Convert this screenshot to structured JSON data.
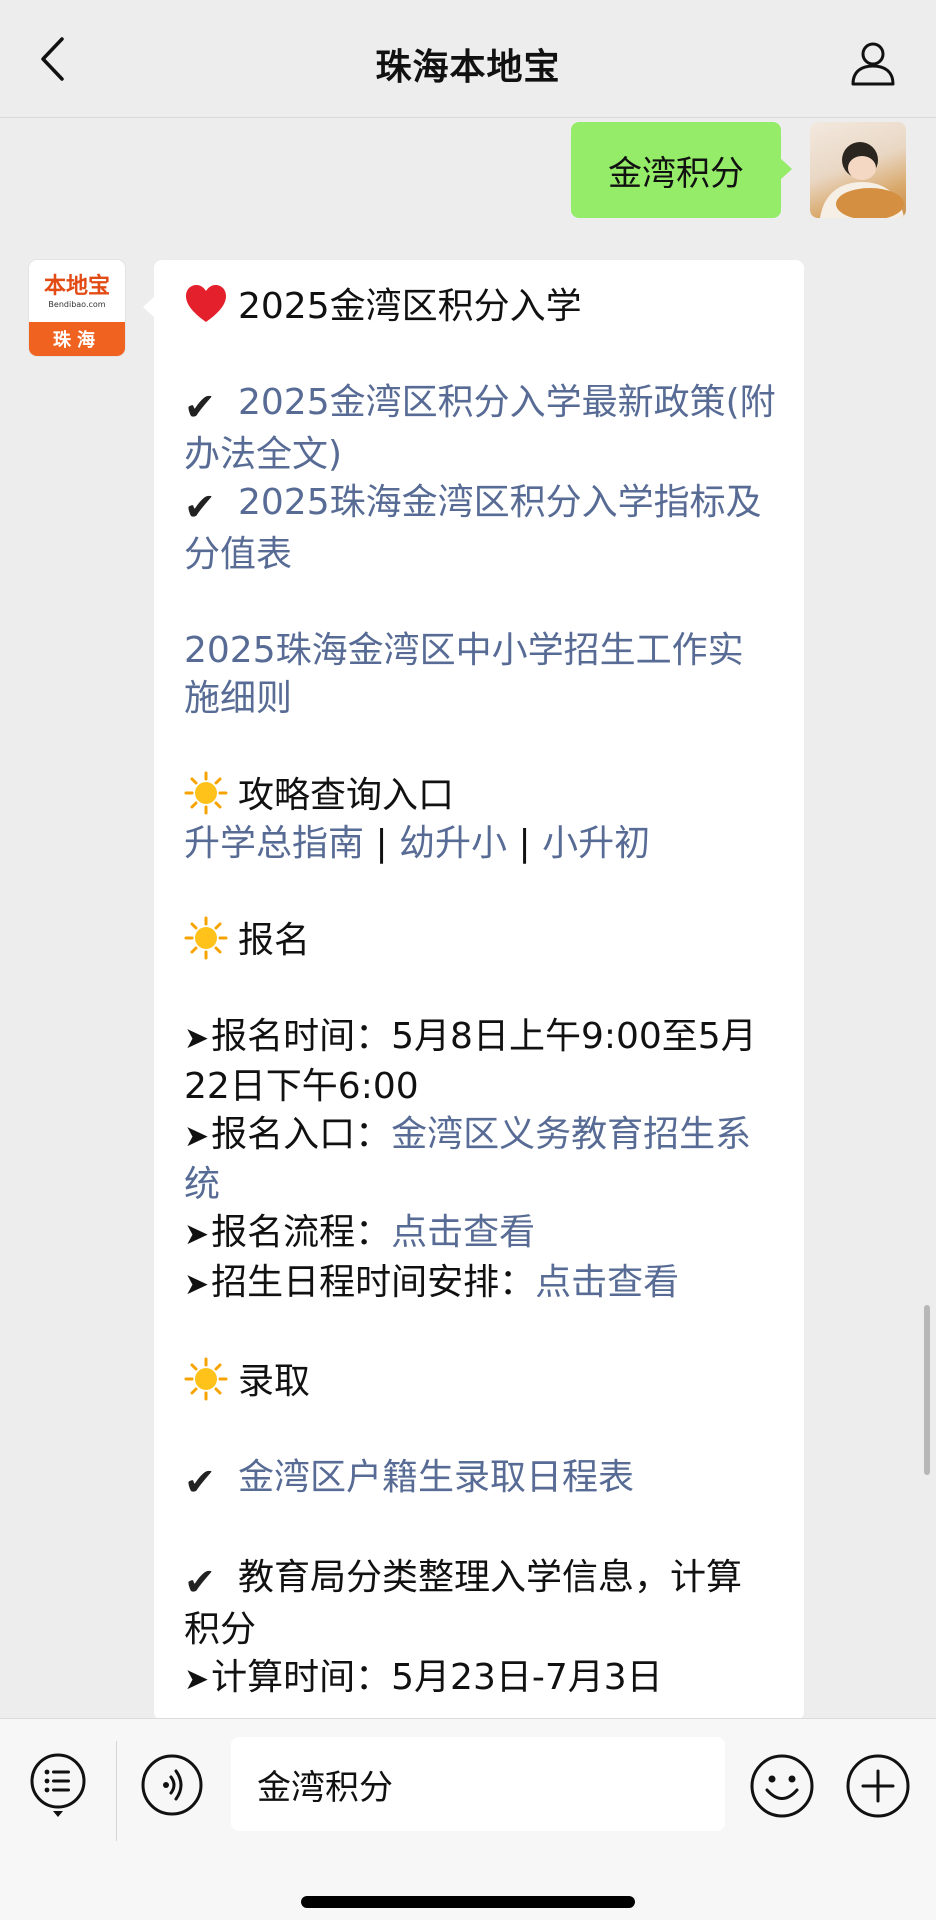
{
  "header": {
    "title": "珠海本地宝"
  },
  "outgoing_message": {
    "text": "金湾积分"
  },
  "bot": {
    "logo_text": "本地宝",
    "logo_sub": "Bendibao.com",
    "logo_city": "珠海"
  },
  "message": {
    "title": "2025金湾区积分入学",
    "link_policy": "2025金湾区积分入学最新政策(附办法全文)",
    "link_indicators": "2025珠海金湾区积分入学指标及分值表",
    "link_rules": "2025珠海金湾区中小学招生工作实施细则",
    "section_guide": "攻略查询入口",
    "guide_link_1": "升学总指南",
    "separator_1": " | ",
    "guide_link_2": "幼升小",
    "separator_2": " | ",
    "guide_link_3": "小升初",
    "section_register": "报名",
    "reg_time_label": "报名时间：",
    "reg_time_value": "5月8日上午9:00至5月22日下午6:00",
    "reg_entry_label": "报名入口：",
    "reg_entry_link": "金湾区义务教育招生系统",
    "reg_flow_label": "报名流程：",
    "reg_flow_link": "点击查看",
    "schedule_label": "招生日程时间安排：",
    "schedule_link": "点击查看",
    "section_admit": "录取",
    "admit_link": "金湾区户籍生录取日程表",
    "edu_text": "教育局分类整理入学信息，计算积分",
    "calc_label": "计算时间：",
    "calc_value": "5月23日-7月3日"
  },
  "input": {
    "value": "金湾积分"
  },
  "colors": {
    "link": "#576b95",
    "outgoing_bubble": "#95ec69",
    "background": "#ededed",
    "brand_orange": "#f0621f"
  }
}
